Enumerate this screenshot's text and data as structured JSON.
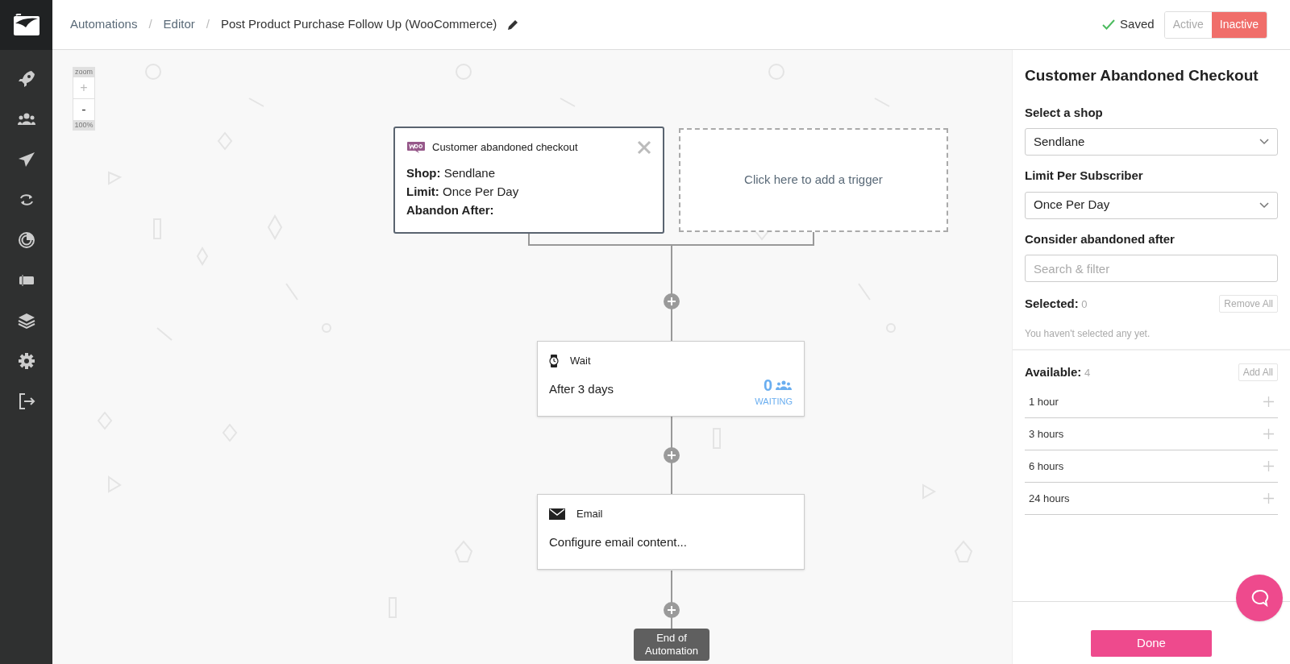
{
  "breadcrumbs": {
    "items": [
      {
        "label": "Automations",
        "current": false
      },
      {
        "label": "Editor",
        "current": false
      },
      {
        "label": "Post Product Purchase Follow Up (WooCommerce)",
        "current": true
      }
    ],
    "separators": [
      "/",
      "/"
    ]
  },
  "save_status": "Saved",
  "status_toggle": [
    {
      "label": "Active",
      "selected": false
    },
    {
      "label": "Inactive",
      "selected": true
    }
  ],
  "zoom": {
    "label": "zoom",
    "zoom_in": "+",
    "zoom_out": "-",
    "level_text": "100%"
  },
  "trigger_card": {
    "title": "Customer abandoned checkout",
    "fields": [
      {
        "label": "Shop:",
        "value": "Sendlane"
      },
      {
        "label": "Limit:",
        "value": "Once Per Day"
      },
      {
        "label": "Abandon After:"
      }
    ]
  },
  "add_trigger": "Click here to add a trigger",
  "steps": [
    {
      "kind": "wait",
      "title": "Wait",
      "description": "After 3 days",
      "count": "0",
      "count_label": "WAITING"
    },
    {
      "kind": "email",
      "title": "Email",
      "description": "Configure email content..."
    }
  ],
  "end_label": "End of Automation",
  "panel": {
    "title": "Customer Abandoned Checkout",
    "fields": [
      {
        "kind": "select",
        "label": "Select a shop",
        "value": "Sendlane"
      },
      {
        "kind": "select",
        "label": "Limit Per Subscriber",
        "value": "Once Per Day"
      },
      {
        "kind": "search",
        "label": "Consider abandoned after",
        "placeholder": "Search & filter"
      }
    ],
    "selected": {
      "label": "Selected:",
      "count": "0",
      "action": "Remove All",
      "empty_text": "You haven't selected any yet."
    },
    "available": {
      "label": "Available:",
      "count": "4",
      "action": "Add All",
      "options": [
        {
          "label": "1 hour"
        },
        {
          "label": "3 hours"
        },
        {
          "label": "6 hours"
        },
        {
          "label": "24 hours"
        }
      ]
    },
    "done_button": "Done"
  }
}
